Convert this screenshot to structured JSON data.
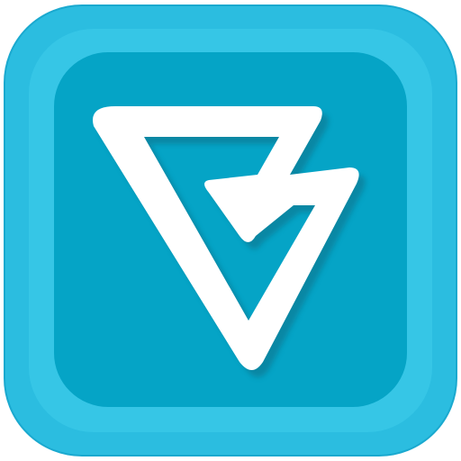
{
  "icon": {
    "name": "app-launcher-icon",
    "glyph": "triangle-logo-icon",
    "colors": {
      "outer_frame": "#2bbde0",
      "outer_frame_edge": "#1aa9cf",
      "inner_ring": "#36c6e6",
      "face": "#05a4c6",
      "glyph": "#ffffff",
      "glyph_shadow": "#0a6f88"
    }
  }
}
